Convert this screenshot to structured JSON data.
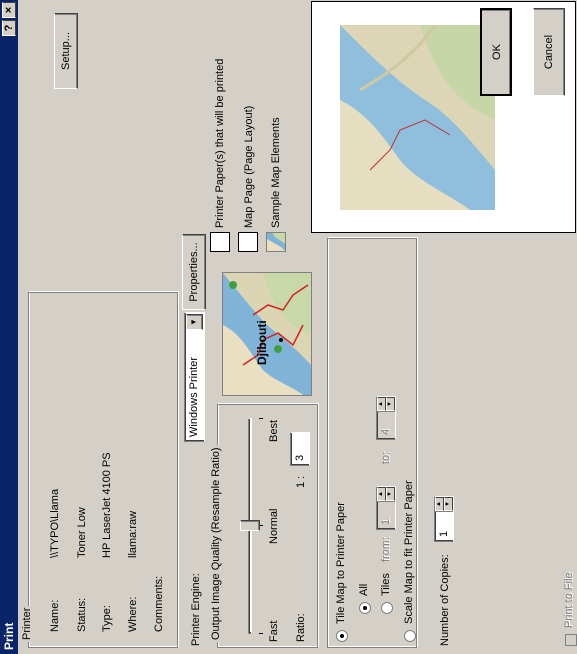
{
  "window": {
    "title": "Print",
    "help": "?",
    "close": "×"
  },
  "printer": {
    "group_label": "Printer",
    "name_label": "Name:",
    "name": "\\\\TYPO\\Llama",
    "status_label": "Status:",
    "status": "Toner Low",
    "type_label": "Type:",
    "type": "HP LaserJet 4100 PS",
    "where_label": "Where:",
    "where": "llama:raw",
    "comments_label": "Comments:",
    "comments": "",
    "setup_button": "Setup..."
  },
  "engine": {
    "label": "Printer Engine:",
    "value": "Windows Printer",
    "properties_button": "Properties..."
  },
  "quality": {
    "group_label": "Output Image Quality (Resample Ratio)",
    "fast": "Fast",
    "normal": "Normal",
    "best": "Best",
    "ratio_label": "Ratio:",
    "ratio_prefix": "1 :",
    "ratio_value": "3",
    "level": 0.5
  },
  "preview_map_label": "Djibouti",
  "tiling": {
    "tile_label": "Tile Map to Printer Paper",
    "all_label": "All",
    "tiles_label": "Tiles",
    "from_label": "from:",
    "from_value": "1",
    "to_label": "to:",
    "to_value": "4",
    "scale_label": "Scale Map to fit Printer Paper"
  },
  "copies": {
    "label": "Number of Copies:",
    "value": "1"
  },
  "print_to_file": "Print to File",
  "legend": {
    "paper": "Printer Paper(s) that will be printed",
    "map_page": "Map Page (Page Layout)",
    "sample": "Sample Map Elements"
  },
  "buttons": {
    "ok": "OK",
    "cancel": "Cancel"
  },
  "colors": {
    "titlebar": "#0a246a",
    "face": "#d4d0c8",
    "land": "#e8e0c0",
    "sea": "#7fb4d8",
    "road": "#d02020",
    "city": "#40a040"
  }
}
